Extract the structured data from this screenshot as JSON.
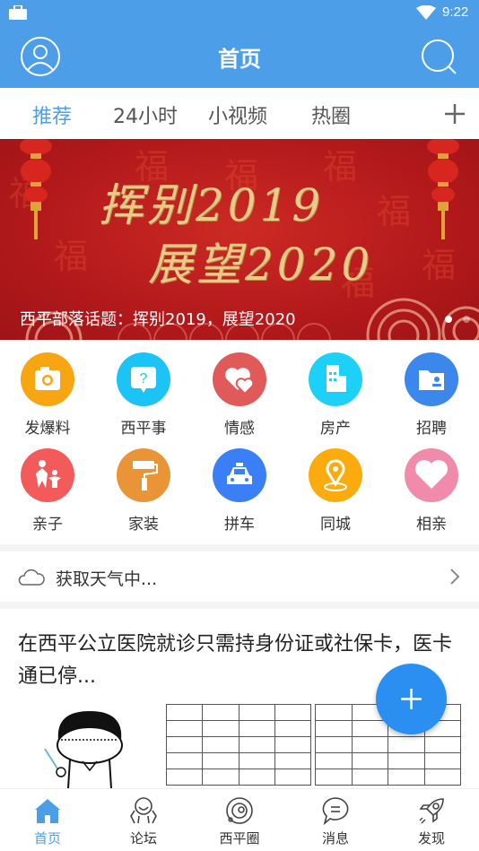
{
  "status_bar": {
    "time": "9:22",
    "icons": [
      "briefcase-icon",
      "wifi-icon"
    ]
  },
  "header": {
    "title": "首页",
    "left_icon": "user-avatar-icon",
    "right_icon": "search-icon"
  },
  "tabs": {
    "items": [
      {
        "label": "推荐",
        "active": true
      },
      {
        "label": "24小时",
        "active": false
      },
      {
        "label": "小视频",
        "active": false
      },
      {
        "label": "热圈",
        "active": false
      }
    ],
    "add_icon": "plus-icon"
  },
  "banner": {
    "line1": "挥别2019",
    "line2": "展望2020",
    "caption": "西平部落话题：挥别2019，展望2020",
    "slide_count": 2,
    "active_slide": 1
  },
  "categories": [
    {
      "label": "发爆料",
      "icon": "camera-icon",
      "color": "#f8a512"
    },
    {
      "label": "西平事",
      "icon": "question-bubble-icon",
      "color": "#1cc3f7"
    },
    {
      "label": "情感",
      "icon": "hearts-icon",
      "color": "#e05a5a"
    },
    {
      "label": "房产",
      "icon": "building-icon",
      "color": "#1cd0f7"
    },
    {
      "label": "招聘",
      "icon": "folder-person-icon",
      "color": "#3b87ec"
    },
    {
      "label": "亲子",
      "icon": "parent-child-icon",
      "color": "#f35b5b"
    },
    {
      "label": "家装",
      "icon": "paint-roller-icon",
      "color": "#ea9438"
    },
    {
      "label": "拼车",
      "icon": "taxi-icon",
      "color": "#3a7ff5"
    },
    {
      "label": "同城",
      "icon": "location-pin-icon",
      "color": "#fbab0e"
    },
    {
      "label": "相亲",
      "icon": "heart-icon",
      "color": "#f08bac"
    }
  ],
  "weather": {
    "text": "获取天气中...",
    "icon": "cloud-icon"
  },
  "article": {
    "title": "在西平公立医院就诊只需持身份证或社保卡，医卡通已停..."
  },
  "fab": {
    "icon": "plus-icon",
    "color": "#2a8ff0"
  },
  "bottom_nav": [
    {
      "label": "首页",
      "icon": "home-icon",
      "active": true
    },
    {
      "label": "论坛",
      "icon": "forum-icon",
      "active": false
    },
    {
      "label": "西平圈",
      "icon": "planet-icon",
      "active": false
    },
    {
      "label": "消息",
      "icon": "message-icon",
      "active": false
    },
    {
      "label": "发现",
      "icon": "rocket-icon",
      "active": false
    }
  ],
  "colors": {
    "primary": "#4d9ee8",
    "banner_red": "#b3191b",
    "text": "#333333"
  }
}
